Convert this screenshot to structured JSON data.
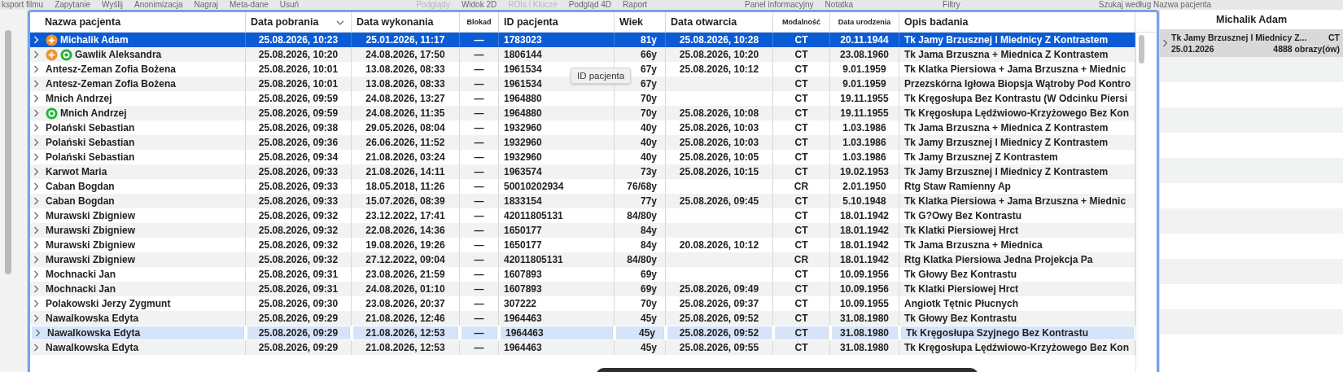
{
  "toolbar": {
    "items": [
      {
        "label": "ksport filmu",
        "disabled": false
      },
      {
        "label": "Zapytanie",
        "disabled": false
      },
      {
        "label": "Wyślij",
        "disabled": false
      },
      {
        "label": "Anonimizacja",
        "disabled": false
      },
      {
        "label": "Nagraj",
        "disabled": false
      },
      {
        "label": "Meta-dane",
        "disabled": false
      },
      {
        "label": "Usuń",
        "disabled": false
      },
      {
        "label": "Podglądy",
        "disabled": true
      },
      {
        "label": "Widok 2D",
        "disabled": false
      },
      {
        "label": "ROIs i Klucze",
        "disabled": true
      },
      {
        "label": "Podgląd 4D",
        "disabled": false
      },
      {
        "label": "Raport",
        "disabled": false
      },
      {
        "label": "Panel informacyjny",
        "disabled": false
      },
      {
        "label": "Notatka",
        "disabled": false
      },
      {
        "label": "Filtry",
        "disabled": false
      },
      {
        "label": "Szukaj według Nazwa pacjenta",
        "disabled": false
      }
    ]
  },
  "table": {
    "columns": [
      {
        "label": "Nazwa pacjenta",
        "small": false,
        "sorted": false
      },
      {
        "label": "Data pobrania",
        "small": false,
        "sorted": true
      },
      {
        "label": "Data wykonania",
        "small": false,
        "sorted": false
      },
      {
        "label": "Blokad",
        "small": true,
        "sorted": false
      },
      {
        "label": "ID pacjenta",
        "small": false,
        "sorted": false
      },
      {
        "label": "Wiek",
        "small": false,
        "sorted": false
      },
      {
        "label": "Data otwarcia",
        "small": false,
        "sorted": false
      },
      {
        "label": "Modalność",
        "small": true,
        "sorted": false
      },
      {
        "label": "Data urodzenia",
        "small": true,
        "sorted": false
      },
      {
        "label": "Opis badania",
        "small": false,
        "sorted": false
      }
    ],
    "rows": [
      {
        "plus_marker": true,
        "ring_marker": false,
        "cells": [
          "Michalik Adam",
          "25.08.2026, 10:23",
          "25.01.2026, 11:17",
          "—",
          "1783023",
          "81y",
          "25.08.2026, 10:28",
          "CT",
          "20.11.1944",
          "Tk Jamy Brzusznej I Miednicy Z Kontrastem"
        ],
        "selected": true,
        "highlighted": false
      },
      {
        "plus_marker": true,
        "ring_marker": true,
        "cells": [
          "Gawlik Aleksandra",
          "25.08.2026, 10:20",
          "24.08.2026, 17:50",
          "—",
          "1806144",
          "66y",
          "25.08.2026, 10:20",
          "CT",
          "23.08.1960",
          "Tk Jama Brzuszna + Miednica Z Kontrastem"
        ],
        "selected": false,
        "highlighted": false
      },
      {
        "plus_marker": false,
        "ring_marker": false,
        "cells": [
          "Antesz-Zeman Zofia Bożena",
          "25.08.2026, 10:01",
          "13.08.2026, 08:33",
          "—",
          "1961534",
          "67y",
          "25.08.2026, 10:12",
          "CT",
          "9.01.1959",
          "Tk Klatka Piersiowa + Jama Brzuszna + Miednic"
        ],
        "selected": false,
        "highlighted": false
      },
      {
        "plus_marker": false,
        "ring_marker": false,
        "cells": [
          "Antesz-Zeman Zofia Bożena",
          "25.08.2026, 10:01",
          "13.08.2026, 08:33",
          "—",
          "1961534",
          "67y",
          "",
          "CT",
          "9.01.1959",
          "Przezskórna Igłowa Biopsja Wątroby Pod Kontro"
        ],
        "selected": false,
        "highlighted": false
      },
      {
        "plus_marker": false,
        "ring_marker": false,
        "cells": [
          "Mnich Andrzej",
          "25.08.2026, 09:59",
          "24.08.2026, 13:27",
          "—",
          "1964880",
          "70y",
          "",
          "CT",
          "19.11.1955",
          "Tk Kręgosłupa Bez Kontrastu (W Odcinku Piersi"
        ],
        "selected": false,
        "highlighted": false
      },
      {
        "plus_marker": false,
        "ring_marker": true,
        "cells": [
          "Mnich Andrzej",
          "25.08.2026, 09:59",
          "24.08.2026, 11:35",
          "—",
          "1964880",
          "70y",
          "25.08.2026, 10:08",
          "CT",
          "19.11.1955",
          "Tk Kręgosłupa Lędźwiowo-Krzyżowego Bez Kon"
        ],
        "selected": false,
        "highlighted": false
      },
      {
        "plus_marker": false,
        "ring_marker": false,
        "cells": [
          "Polański Sebastian",
          "25.08.2026, 09:38",
          "29.05.2026, 08:04",
          "—",
          "1932960",
          "40y",
          "25.08.2026, 10:03",
          "CT",
          "1.03.1986",
          "Tk Jama Brzuszna + Miednica Z Kontrastem"
        ],
        "selected": false,
        "highlighted": false
      },
      {
        "plus_marker": false,
        "ring_marker": false,
        "cells": [
          "Polański Sebastian",
          "25.08.2026, 09:36",
          "26.06.2026, 11:52",
          "—",
          "1932960",
          "40y",
          "25.08.2026, 10:03",
          "CT",
          "1.03.1986",
          "Tk Jamy Brzusznej I Miednicy Z Kontrastem"
        ],
        "selected": false,
        "highlighted": false
      },
      {
        "plus_marker": false,
        "ring_marker": false,
        "cells": [
          "Polański Sebastian",
          "25.08.2026, 09:34",
          "21.08.2026, 03:24",
          "—",
          "1932960",
          "40y",
          "25.08.2026, 10:05",
          "CT",
          "1.03.1986",
          "Tk Jamy Brzusznej Z Kontrastem"
        ],
        "selected": false,
        "highlighted": false
      },
      {
        "plus_marker": false,
        "ring_marker": false,
        "cells": [
          "Karwot Maria",
          "25.08.2026, 09:33",
          "21.08.2026, 14:11",
          "—",
          "1963574",
          "73y",
          "25.08.2026, 10:15",
          "CT",
          "19.02.1953",
          "Tk Jamy Brzusznej I Miednicy Z Kontrastem"
        ],
        "selected": false,
        "highlighted": false
      },
      {
        "plus_marker": false,
        "ring_marker": false,
        "cells": [
          "Caban Bogdan",
          "25.08.2026, 09:33",
          "18.05.2018, 11:26",
          "—",
          "50010202934",
          "76/68y",
          "",
          "CR",
          "2.01.1950",
          "Rtg Staw Ramienny Ap"
        ],
        "selected": false,
        "highlighted": false
      },
      {
        "plus_marker": false,
        "ring_marker": false,
        "cells": [
          "Caban Bogdan",
          "25.08.2026, 09:33",
          "15.07.2026, 08:39",
          "—",
          "1833154",
          "77y",
          "25.08.2026, 09:45",
          "CT",
          "5.10.1948",
          "Tk Klatka Piersiowa + Jama Brzuszna + Miednic"
        ],
        "selected": false,
        "highlighted": false
      },
      {
        "plus_marker": false,
        "ring_marker": false,
        "cells": [
          "Murawski Zbigniew",
          "25.08.2026, 09:32",
          "23.12.2022, 17:41",
          "—",
          "42011805131",
          "84/80y",
          "",
          "CT",
          "18.01.1942",
          "Tk G?Owy Bez Kontrastu"
        ],
        "selected": false,
        "highlighted": false
      },
      {
        "plus_marker": false,
        "ring_marker": false,
        "cells": [
          "Murawski Zbigniew",
          "25.08.2026, 09:32",
          "22.08.2026, 14:36",
          "—",
          "1650177",
          "84y",
          "",
          "CT",
          "18.01.1942",
          "Tk Klatki Piersiowej Hrct"
        ],
        "selected": false,
        "highlighted": false
      },
      {
        "plus_marker": false,
        "ring_marker": false,
        "cells": [
          "Murawski Zbigniew",
          "25.08.2026, 09:32",
          "19.08.2026, 19:26",
          "—",
          "1650177",
          "84y",
          "20.08.2026, 10:12",
          "CT",
          "18.01.1942",
          "Tk Jama Brzuszna + Miednica"
        ],
        "selected": false,
        "highlighted": false
      },
      {
        "plus_marker": false,
        "ring_marker": false,
        "cells": [
          "Murawski Zbigniew",
          "25.08.2026, 09:32",
          "27.12.2022, 09:04",
          "—",
          "42011805131",
          "84/80y",
          "",
          "CR",
          "18.01.1942",
          "Rtg Klatka Piersiowa Jedna Projekcja Pa"
        ],
        "selected": false,
        "highlighted": false
      },
      {
        "plus_marker": false,
        "ring_marker": false,
        "cells": [
          "Mochnacki Jan",
          "25.08.2026, 09:31",
          "23.08.2026, 21:59",
          "—",
          "1607893",
          "69y",
          "",
          "CT",
          "10.09.1956",
          "Tk Głowy Bez Kontrastu"
        ],
        "selected": false,
        "highlighted": false
      },
      {
        "plus_marker": false,
        "ring_marker": false,
        "cells": [
          "Mochnacki Jan",
          "25.08.2026, 09:31",
          "24.08.2026, 01:10",
          "—",
          "1607893",
          "69y",
          "25.08.2026, 09:49",
          "CT",
          "10.09.1956",
          "Tk Klatki Piersiowej Hrct"
        ],
        "selected": false,
        "highlighted": false
      },
      {
        "plus_marker": false,
        "ring_marker": false,
        "cells": [
          "Polakowski Jerzy Zygmunt",
          "25.08.2026, 09:30",
          "23.08.2026, 20:37",
          "—",
          "307222",
          "70y",
          "25.08.2026, 09:37",
          "CT",
          "10.09.1955",
          "Angiotk Tętnic Płucnych"
        ],
        "selected": false,
        "highlighted": false
      },
      {
        "plus_marker": false,
        "ring_marker": false,
        "cells": [
          "Nawalkowska Edyta",
          "25.08.2026, 09:29",
          "21.08.2026, 12:46",
          "—",
          "1964463",
          "45y",
          "25.08.2026, 09:52",
          "CT",
          "31.08.1980",
          "Tk Głowy Bez Kontrastu"
        ],
        "selected": false,
        "highlighted": false
      },
      {
        "plus_marker": false,
        "ring_marker": false,
        "cells": [
          "Nawalkowska Edyta",
          "25.08.2026, 09:29",
          "21.08.2026, 12:53",
          "—",
          "1964463",
          "45y",
          "25.08.2026, 09:52",
          "CT",
          "31.08.1980",
          "Tk Kręgosłupa Szyjnego Bez Kontrastu"
        ],
        "selected": false,
        "highlighted": true
      },
      {
        "plus_marker": false,
        "ring_marker": false,
        "cells": [
          "Nawalkowska Edyta",
          "25.08.2026, 09:29",
          "21.08.2026, 12:53",
          "—",
          "1964463",
          "45y",
          "25.08.2026, 09:55",
          "CT",
          "31.08.1980",
          "Tk Kręgosłupa Lędźwiowo-Krzyżowego Bez Kon"
        ],
        "selected": false,
        "highlighted": false
      }
    ]
  },
  "tooltip": "ID pacjenta",
  "study_panel": {
    "title": "Michalik Adam",
    "items": [
      {
        "description": "Tk Jamy Brzusznej I Miednicy Z...",
        "modality": "CT",
        "date": "25.01.2026",
        "images": "4888 obrazy(ów)",
        "selected": true
      }
    ]
  }
}
